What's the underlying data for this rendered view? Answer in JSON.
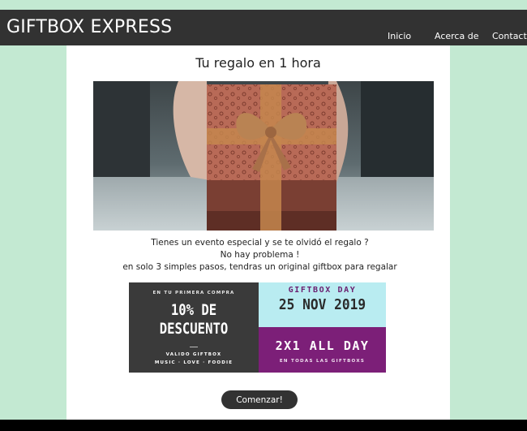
{
  "header": {
    "brand": "GIFTBOX EXPRESS",
    "nav": [
      {
        "label": "Inicio"
      },
      {
        "label": "Acerca de"
      },
      {
        "label": "Contacto"
      }
    ]
  },
  "main": {
    "title": "Tu regalo en 1 hora",
    "description": [
      "Tienes un evento especial y se te olvidó el regalo ?",
      "No hay problema !",
      "en solo 3 simples pasos, tendras un original giftbox para regalar"
    ],
    "promo": {
      "left_top": "EN TU PRIMERA COMPRA",
      "left_line1": "10% DE",
      "left_line2": "DESCUENTO",
      "left_bottom1": "VALIDO GIFTBOX",
      "left_bottom2": "MUSIC · LOVE · FOODIE",
      "right_label": "GIFTBOX DAY",
      "right_date": "25 NOV 2019",
      "right_big": "2X1 ALL DAY",
      "right_small": "EN TODAS LAS GIFTBOXS"
    },
    "cta_label": "Comenzar!"
  },
  "colors": {
    "background": "#c3e9d2",
    "navbar": "#323232",
    "promo_dark": "#3a3a3a",
    "promo_cyan": "#b9ecf1",
    "promo_purple": "#7c1f78"
  }
}
